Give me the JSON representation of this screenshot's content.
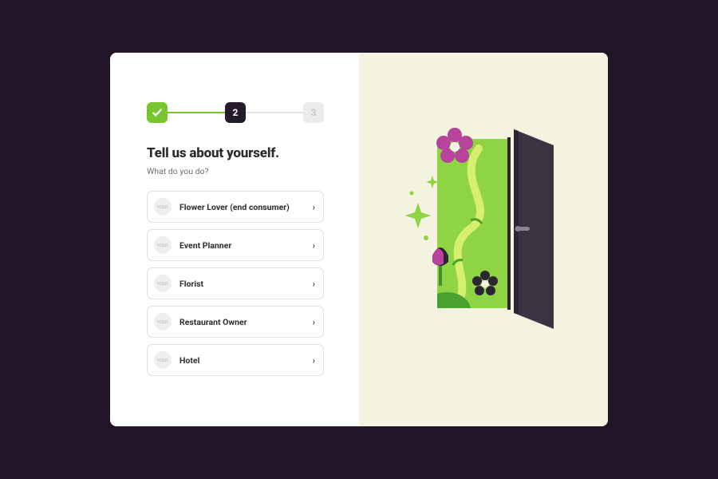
{
  "stepper": {
    "steps": [
      {
        "state": "done"
      },
      {
        "label": "2",
        "state": "current"
      },
      {
        "label": "3",
        "state": "future"
      }
    ]
  },
  "heading": "Tell us about yourself.",
  "subheading": "What do you do?",
  "options": [
    {
      "icon_label": "Icon",
      "label": "Flower Lover (end consumer)"
    },
    {
      "icon_label": "Icon",
      "label": "Event Planner"
    },
    {
      "icon_label": "Icon",
      "label": "Florist"
    },
    {
      "icon_label": "Icon",
      "label": "Restaurant Owner"
    },
    {
      "icon_label": "Icon",
      "label": "Hotel"
    }
  ],
  "colors": {
    "accent_green": "#78c52e",
    "dark": "#251b2b",
    "panel_right": "#f4f3e0",
    "magenta": "#b8439c"
  }
}
